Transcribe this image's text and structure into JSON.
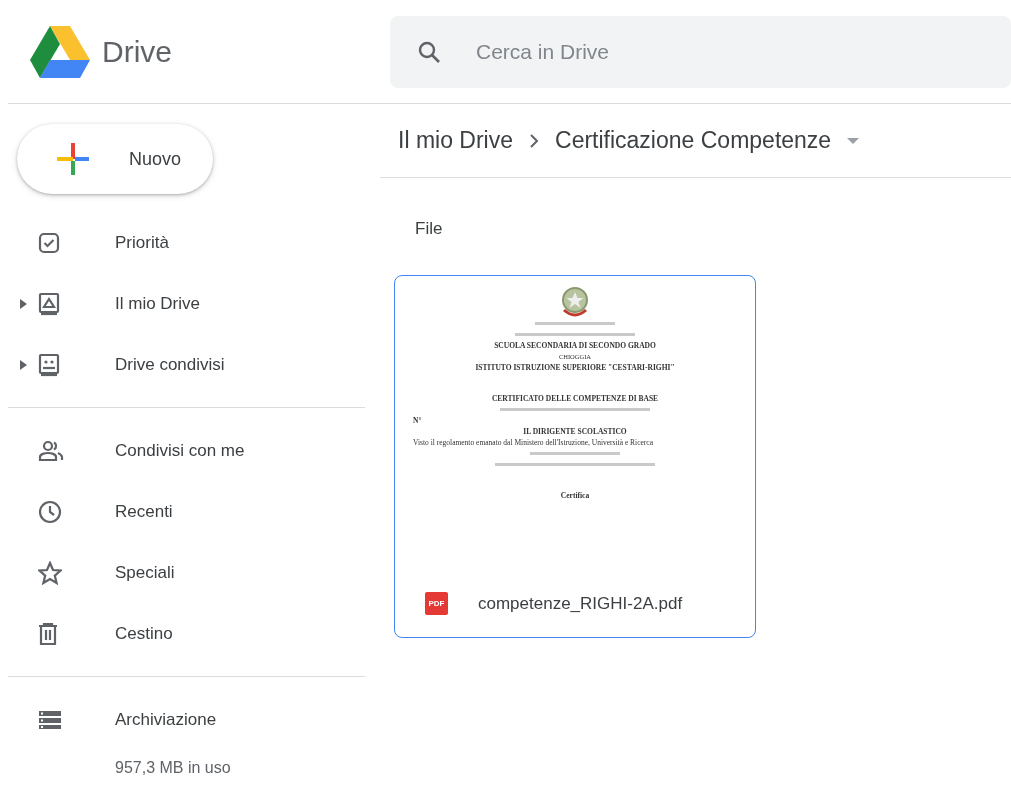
{
  "app": {
    "name": "Drive"
  },
  "search": {
    "placeholder": "Cerca in Drive"
  },
  "new_button": {
    "label": "Nuovo"
  },
  "sidebar": {
    "sections": [
      {
        "items": [
          {
            "label": "Priorità"
          },
          {
            "label": "Il mio Drive",
            "expanded": false
          },
          {
            "label": "Drive condivisi",
            "expanded": false
          }
        ]
      },
      {
        "items": [
          {
            "label": "Condivisi con me"
          },
          {
            "label": "Recenti"
          },
          {
            "label": "Speciali"
          },
          {
            "label": "Cestino"
          }
        ]
      },
      {
        "items": [
          {
            "label": "Archiviazione"
          }
        ]
      }
    ],
    "storage_usage": "957,3 MB in uso"
  },
  "breadcrumb": [
    "Il mio Drive",
    "Certificazione Competenze"
  ],
  "section_title": "File",
  "files": [
    {
      "name": "competenze_RIGHI-2A.pdf",
      "badge": "PDF",
      "selected": true,
      "preview": {
        "lines": [
          {
            "kind": "fine"
          },
          {
            "kind": "fine"
          },
          {
            "kind": "heading",
            "text": "SCUOLA SECONDARIA DI SECONDO GRADO"
          },
          {
            "kind": "sub",
            "text": "CHIOGGIA"
          },
          {
            "kind": "heading",
            "text": "ISTITUTO ISTRUZIONE SUPERIORE \"CESTARI-RIGHI\""
          },
          {
            "kind": "gap"
          },
          {
            "kind": "heading",
            "text": "CERTIFICATO DELLE COMPETENZE DI BASE"
          },
          {
            "kind": "fine"
          },
          {
            "kind": "left",
            "text": "N°"
          },
          {
            "kind": "heading",
            "text": "IL DIRIGENTE SCOLASTICO"
          },
          {
            "kind": "body",
            "text": "Visto il regolamento emanato dal Ministero dell'Istruzione, Università e Ricerca"
          },
          {
            "kind": "fine"
          },
          {
            "kind": "fine"
          },
          {
            "kind": "gap"
          },
          {
            "kind": "heading",
            "text": "Certifica"
          }
        ]
      }
    }
  ]
}
